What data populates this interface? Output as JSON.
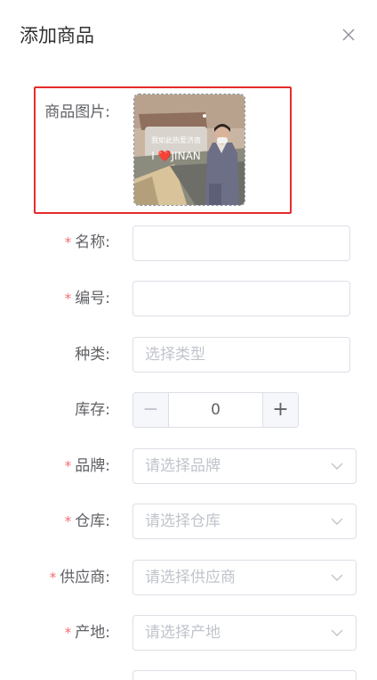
{
  "dialog": {
    "title": "添加商品"
  },
  "form": {
    "image_label": "商品图片:",
    "image_text_line1": "我如此热爱济南",
    "image_text_line2": "I ❤️JINAN",
    "name_label": "名称:",
    "code_label": "编号:",
    "category_label": "种类:",
    "category_placeholder": "选择类型",
    "stock_label": "库存:",
    "stock_value": "0",
    "brand_label": "品牌:",
    "brand_placeholder": "请选择品牌",
    "warehouse_label": "仓库:",
    "warehouse_placeholder": "请选择仓库",
    "supplier_label": "供应商:",
    "supplier_placeholder": "请选择供应商",
    "origin_label": "产地:",
    "origin_placeholder": "请选择产地",
    "required_mark": "*"
  },
  "stepper": {
    "minus": "−",
    "plus": "+"
  },
  "colors": {
    "required": "#f56c6c",
    "highlight_border": "#e62b2b",
    "placeholder": "#c0c4cc",
    "border": "#dcdfe6"
  }
}
